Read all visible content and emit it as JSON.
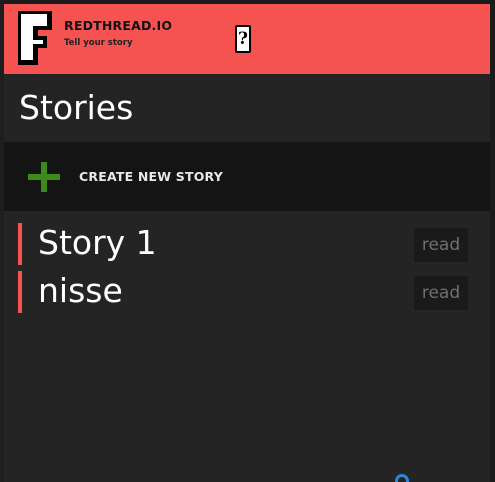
{
  "header": {
    "brand_title": "REDTHREAD.IO",
    "brand_subtitle": "Tell your story",
    "help_label": "?",
    "logo_letter": "F",
    "colors": {
      "header_bg": "#f55252",
      "accent": "#f55252"
    }
  },
  "page": {
    "title": "Stories"
  },
  "create_bar": {
    "label": "CREATE NEW STORY",
    "icon": "plus-icon",
    "icon_color": "#3b8a1a"
  },
  "stories": [
    {
      "title": "Story 1",
      "action": "read"
    },
    {
      "title": "nisse",
      "action": "read"
    }
  ]
}
